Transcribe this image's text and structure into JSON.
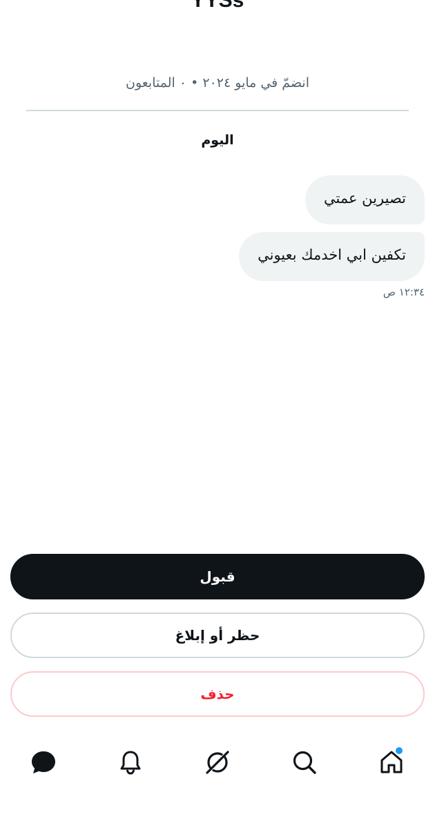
{
  "profile": {
    "name": "YYSs",
    "meta": "انضمّ في مايو ٢٠٢٤ • ٠ المتابعون"
  },
  "conversation": {
    "day_label": "اليوم",
    "messages": [
      {
        "text": "تصيرين عمتي"
      },
      {
        "text": "تكفين ابي اخدمك بعيوني"
      }
    ],
    "last_message_time": "١٢:٣٤ ص"
  },
  "actions": {
    "accept_label": "قبول",
    "block_label": "حظر أو إبلاغ",
    "delete_label": "حذف"
  },
  "bottom_nav": {
    "items": [
      {
        "icon": "messages-icon",
        "active": true
      },
      {
        "icon": "bell-icon",
        "active": false
      },
      {
        "icon": "grok-icon",
        "active": false
      },
      {
        "icon": "search-icon",
        "active": false
      },
      {
        "icon": "home-icon",
        "active": false,
        "has_notification_dot": true
      }
    ]
  },
  "colors": {
    "primary_text": "#0f1419",
    "secondary_text": "#536471",
    "bubble_background": "#eff3f4",
    "accept_button": "#0f1419",
    "delete_text": "#f4212e",
    "notification_dot": "#1d9bf0"
  }
}
